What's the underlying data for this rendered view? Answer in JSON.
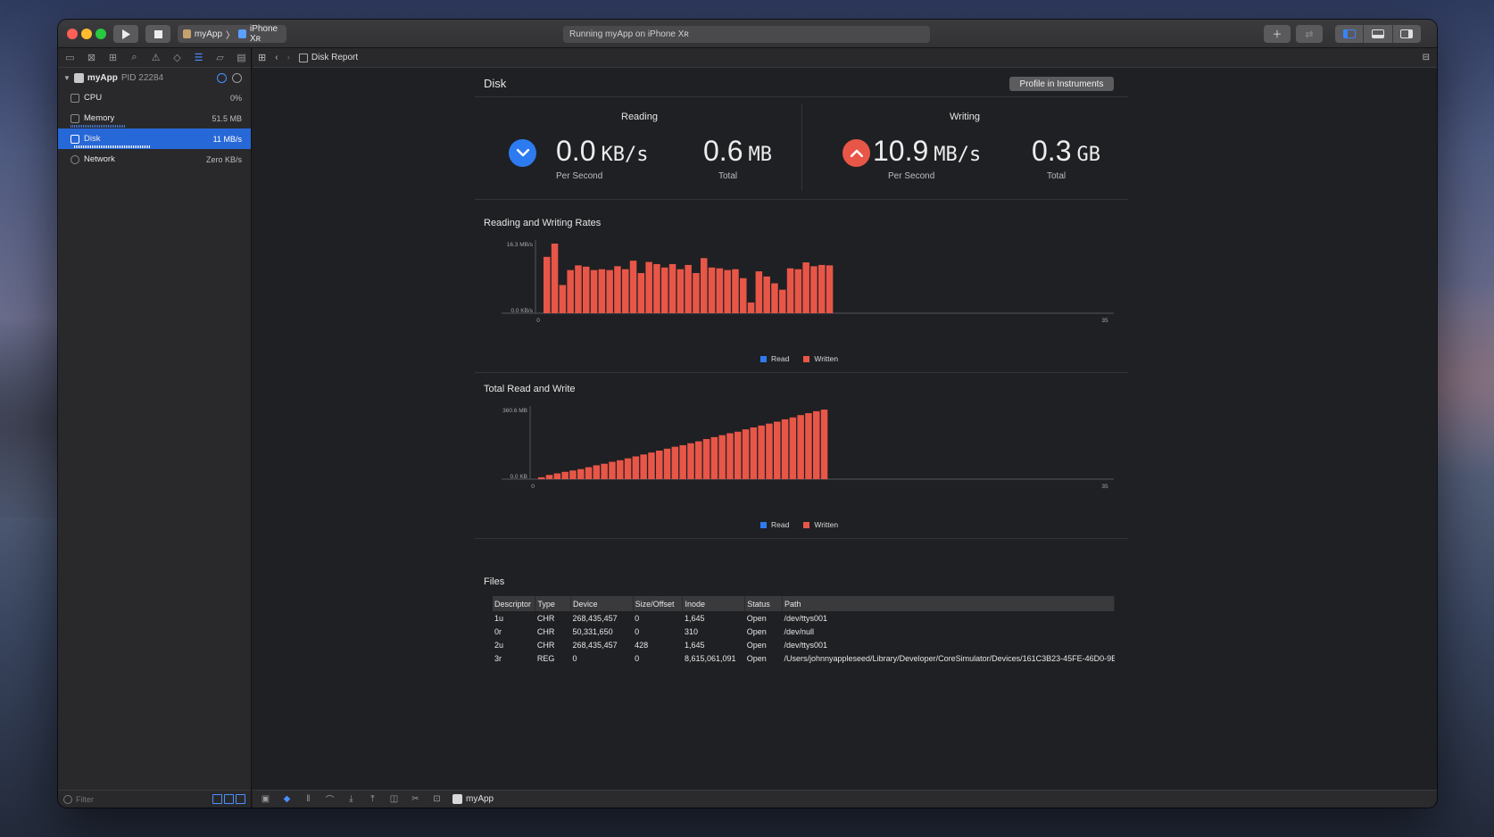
{
  "titlebar": {
    "scheme": "myApp",
    "device": "iPhone Xʀ",
    "activity": "Running myApp on iPhone Xʀ"
  },
  "navigator": {
    "process": {
      "name": "myApp",
      "pid": "PID 22284"
    },
    "gauges": [
      {
        "label": "CPU",
        "value": "0%"
      },
      {
        "label": "Memory",
        "value": "51.5 MB"
      },
      {
        "label": "Disk",
        "value": "11 MB/s"
      },
      {
        "label": "Network",
        "value": "Zero KB/s"
      }
    ],
    "filter_placeholder": "Filter"
  },
  "jumpbar": {
    "crumb": "Disk Report"
  },
  "report": {
    "title": "Disk",
    "profile_button": "Profile in Instruments",
    "reading": {
      "label": "Reading",
      "rate_value": "0.0",
      "rate_unit": "KB/s",
      "rate_caption": "Per Second",
      "total_value": "0.6",
      "total_unit": "MB",
      "total_caption": "Total"
    },
    "writing": {
      "label": "Writing",
      "rate_value": "10.9",
      "rate_unit": "MB/s",
      "rate_caption": "Per Second",
      "total_value": "0.3",
      "total_unit": "GB",
      "total_caption": "Total"
    },
    "colors": {
      "read": "#2d7bf0",
      "written": "#e85648"
    },
    "legend": {
      "read": "Read",
      "written": "Written"
    }
  },
  "chart_data": [
    {
      "type": "bar",
      "title": "Reading and Writing Rates",
      "y_tick_labels": [
        "16.3 MB/s",
        "0.0 KB/s"
      ],
      "ylim": [
        0,
        16.3
      ],
      "x_tick_labels": [
        "0",
        "35"
      ],
      "xlim": [
        0,
        35
      ],
      "legend": [
        "Read",
        "Written"
      ],
      "series": [
        {
          "name": "Read",
          "values": [
            0,
            0,
            0,
            0,
            0,
            0,
            0,
            0,
            0,
            0,
            0,
            0,
            0,
            0,
            0,
            0,
            0,
            0,
            0,
            0,
            0,
            0,
            0,
            0,
            0,
            0,
            0,
            0,
            0,
            0,
            0,
            0,
            0,
            0,
            0
          ]
        },
        {
          "name": "Written",
          "values": [
            13.2,
            16.3,
            6.6,
            10.1,
            11.2,
            10.9,
            10.1,
            10.3,
            10.1,
            11.0,
            10.3,
            12.3,
            9.4,
            12.0,
            11.5,
            10.7,
            11.5,
            10.3,
            11.3,
            9.4,
            12.9,
            10.7,
            10.5,
            10.1,
            10.3,
            8.2,
            2.5,
            9.8,
            8.6,
            7.0,
            5.5,
            10.5,
            10.3,
            11.9,
            11.0,
            11.3,
            11.2
          ]
        }
      ]
    },
    {
      "type": "bar",
      "title": "Total Read and Write",
      "y_tick_labels": [
        "360.6 MB",
        "0.0 KB"
      ],
      "ylim": [
        0,
        360.6
      ],
      "x_tick_labels": [
        "0",
        "35"
      ],
      "xlim": [
        0,
        35
      ],
      "legend": [
        "Read",
        "Written"
      ],
      "series": [
        {
          "name": "Read",
          "values": [
            0,
            0,
            0,
            0,
            0,
            0,
            0,
            0,
            0,
            0,
            0,
            0,
            0,
            0,
            0,
            0,
            0,
            0,
            0,
            0,
            0,
            0,
            0,
            0,
            0,
            0,
            0,
            0,
            0,
            0,
            0,
            0,
            0,
            0,
            0,
            0
          ]
        },
        {
          "name": "Written",
          "values": [
            10,
            22,
            30,
            38,
            45,
            52,
            62,
            72,
            80,
            90,
            98,
            108,
            118,
            128,
            138,
            148,
            158,
            168,
            176,
            186,
            196,
            208,
            218,
            228,
            238,
            246,
            258,
            268,
            278,
            288,
            298,
            310,
            320,
            332,
            342,
            352,
            360.6
          ]
        }
      ]
    }
  ],
  "files": {
    "title": "Files",
    "columns": [
      "Descriptor",
      "Type",
      "Device",
      "Size/Offset",
      "Inode",
      "Status",
      "Path"
    ],
    "rows": [
      [
        "1u",
        "CHR",
        "268,435,457",
        "0",
        "1,645",
        "Open",
        "/dev/ttys001"
      ],
      [
        "0r",
        "CHR",
        "50,331,650",
        "0",
        "310",
        "Open",
        "/dev/null"
      ],
      [
        "2u",
        "CHR",
        "268,435,457",
        "428",
        "1,645",
        "Open",
        "/dev/ttys001"
      ],
      [
        "3r",
        "REG",
        "0",
        "0",
        "8,615,061,091",
        "Open",
        "/Users/johnnyappleseed/Library/Developer/CoreSimulator/Devices/161C3B23-45FE-46D0-9E"
      ]
    ]
  },
  "debugbar": {
    "app": "myApp"
  }
}
